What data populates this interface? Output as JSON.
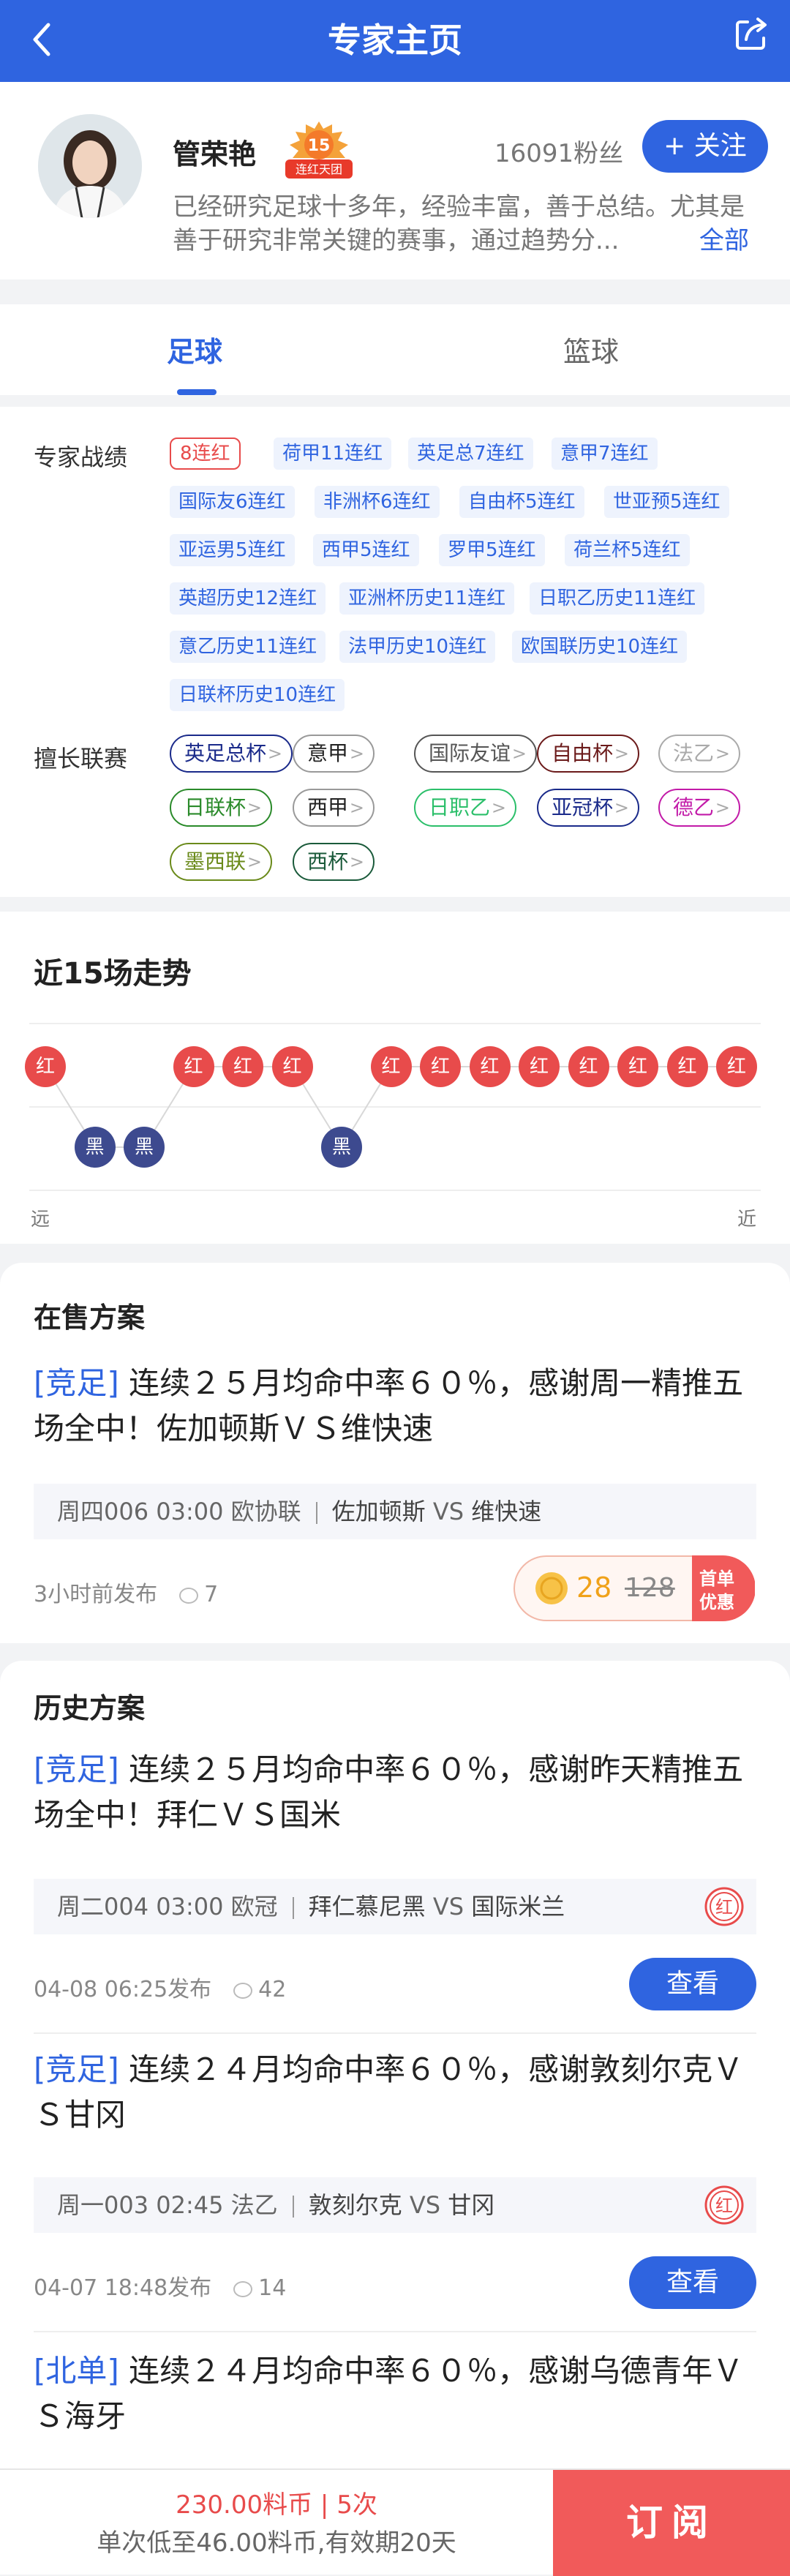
{
  "header": {
    "title": "专家主页"
  },
  "profile": {
    "name": "管荣艳",
    "medal_number": "15",
    "medal_text": "连红天团",
    "fans": "16091粉丝",
    "follow_label": "关注",
    "intro": "已经研究足球十多年，经验丰富，善于总结。尤其是善于研究非常关键的赛事，通过趋势分...",
    "more_label": "全部"
  },
  "tabs": {
    "football": "足球",
    "basketball": "篮球"
  },
  "record": {
    "label": "专家战绩",
    "highlight": "8连红",
    "tags": [
      "荷甲11连红",
      "英足总7连红",
      "意甲7连红",
      "国际友6连红",
      "非洲杯6连红",
      "自由杯5连红",
      "世亚预5连红",
      "亚运男5连红",
      "西甲5连红",
      "罗甲5连红",
      "荷兰杯5连红",
      "英超历史12连红",
      "亚洲杯历史11连红",
      "日职乙历史11连红",
      "意乙历史11连红",
      "法甲历史10连红",
      "欧国联历史10连红",
      "日联杯历史10连红"
    ]
  },
  "leagues": {
    "label": "擅长联赛",
    "items": [
      {
        "name": "英足总杯",
        "color": "#1a2a8a"
      },
      {
        "name": "意甲",
        "color": "#222222"
      },
      {
        "name": "国际友谊",
        "color": "#555555"
      },
      {
        "name": "自由杯",
        "color": "#6b1a1a"
      },
      {
        "name": "法乙",
        "color": "#aaaaaa"
      },
      {
        "name": "日联杯",
        "color": "#2a8a2a"
      },
      {
        "name": "西甲",
        "color": "#222222"
      },
      {
        "name": "日职乙",
        "color": "#2bbf6a"
      },
      {
        "name": "亚冠杯",
        "color": "#1a2a8a"
      },
      {
        "name": "德乙",
        "color": "#c21aa8"
      },
      {
        "name": "墨西联",
        "color": "#6a8a1a"
      },
      {
        "name": "西杯",
        "color": "#1a5a3a"
      }
    ]
  },
  "trend": {
    "title": "近15场走势",
    "results": [
      "红",
      "黑",
      "黑",
      "红",
      "红",
      "红",
      "黑",
      "红",
      "红",
      "红",
      "红",
      "红",
      "红",
      "红",
      "红"
    ],
    "far": "远",
    "near": "近"
  },
  "on_sale": {
    "title": "在售方案",
    "plan": {
      "tag": "[竞足]",
      "text": " 连续２５月均命中率６０％，感谢周一精推五场全中！佐加顿斯ＶＳ维快速",
      "match_info": "周四006 03:00 欧协联",
      "home": "佐加顿斯",
      "vs": "VS",
      "away": "维快速",
      "time": "3小时前发布",
      "views": "7",
      "price": "28",
      "orig_price": "128",
      "promo_line1": "首单",
      "promo_line2": "优惠"
    }
  },
  "history": {
    "title": "历史方案",
    "view_label": "查看",
    "hit_label": "红",
    "plans": [
      {
        "tag": "[竞足]",
        "text": " 连续２５月均命中率６０％，感谢昨天精推五场全中！拜仁ＶＳ国米",
        "match_info": "周二004 03:00 欧冠",
        "home": "拜仁慕尼黑",
        "vs": "VS",
        "away": "国际米兰",
        "time": "04-08 06:25发布",
        "views": "42"
      },
      {
        "tag": "[竞足]",
        "text": " 连续２４月均命中率６０％，感谢敦刻尔克ＶＳ甘冈",
        "match_info": "周一003 02:45 法乙",
        "home": "敦刻尔克",
        "vs": "VS",
        "away": "甘冈",
        "time": "04-07 18:48发布",
        "views": "14"
      },
      {
        "tag": "[北单]",
        "text": " 连续２４月均命中率６０％，感谢乌德青年ＶＳ海牙"
      }
    ]
  },
  "bottom": {
    "price": "230.00料币 | 5次",
    "sub": "单次低至46.00料币,有效期20天",
    "subscribe": "订阅"
  }
}
